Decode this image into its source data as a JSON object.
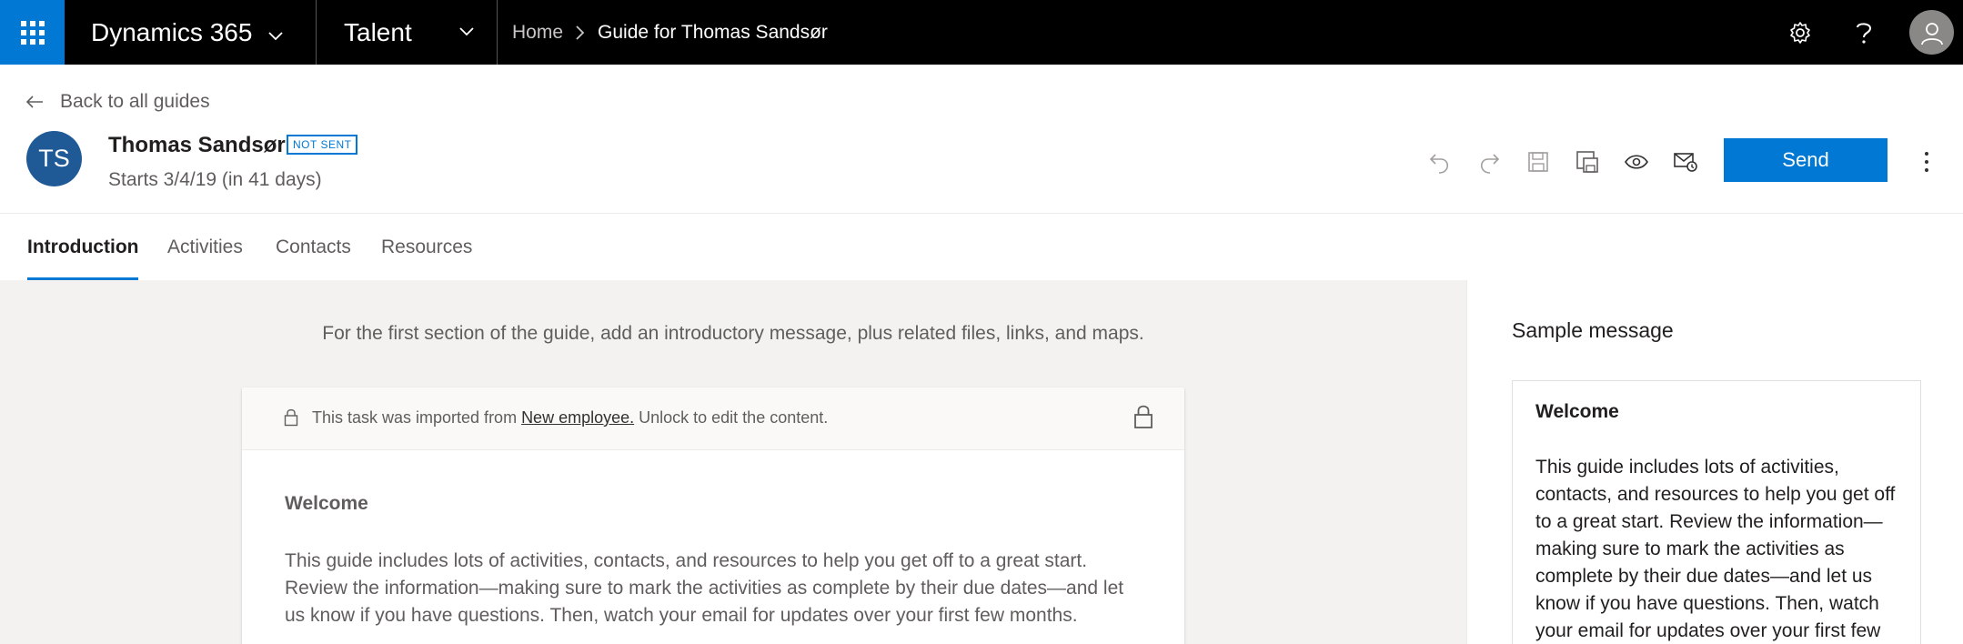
{
  "nav": {
    "app_name": "Dynamics 365",
    "module_name": "Talent",
    "breadcrumb": {
      "home": "Home",
      "current": "Guide for Thomas Sandsør"
    },
    "icons": [
      "waffle-icon",
      "settings-icon",
      "help-icon",
      "user-avatar-icon"
    ]
  },
  "header": {
    "back_link": "Back to all guides",
    "avatar_initials": "TS",
    "person_name": "Thomas Sandsør",
    "status_badge": "NOT SENT",
    "start_date": "Starts 3/4/19 (in 41 days)",
    "send_label": "Send",
    "toolbar_icons": [
      "undo-icon",
      "redo-icon",
      "save-icon",
      "save-as-icon",
      "preview-icon",
      "email-preview-icon",
      "more-icon"
    ]
  },
  "tabs": [
    {
      "label": "Introduction",
      "active": true
    },
    {
      "label": "Activities",
      "active": false
    },
    {
      "label": "Contacts",
      "active": false
    },
    {
      "label": "Resources",
      "active": false
    }
  ],
  "main": {
    "intro_text": "For the first section of the guide, add an introductory message, plus related files, links, and maps.",
    "banner": {
      "prefix": "This task was imported from ",
      "link": "New employee.",
      "suffix": " Unlock to edit the content."
    },
    "heading": "Welcome",
    "body": "This guide includes lots of activities, contacts, and resources to help you get off to a great start. Review the information—making sure to mark the activities as complete by their due dates—and let us know if you have questions. Then, watch your email for updates over your first few months."
  },
  "side_panel": {
    "title": "Sample message",
    "heading": "Welcome",
    "body": "This guide includes lots of activities, contacts, and resources to help you get off to a great start. Review the information—making sure to mark the activities as complete by their due dates—and let us know if you have questions. Then, watch your email for updates over your first few months."
  },
  "colors": {
    "accent": "#0078d4",
    "avatar": "#1f5a96",
    "topbar": "#000000",
    "canvas": "#f3f2f1"
  }
}
